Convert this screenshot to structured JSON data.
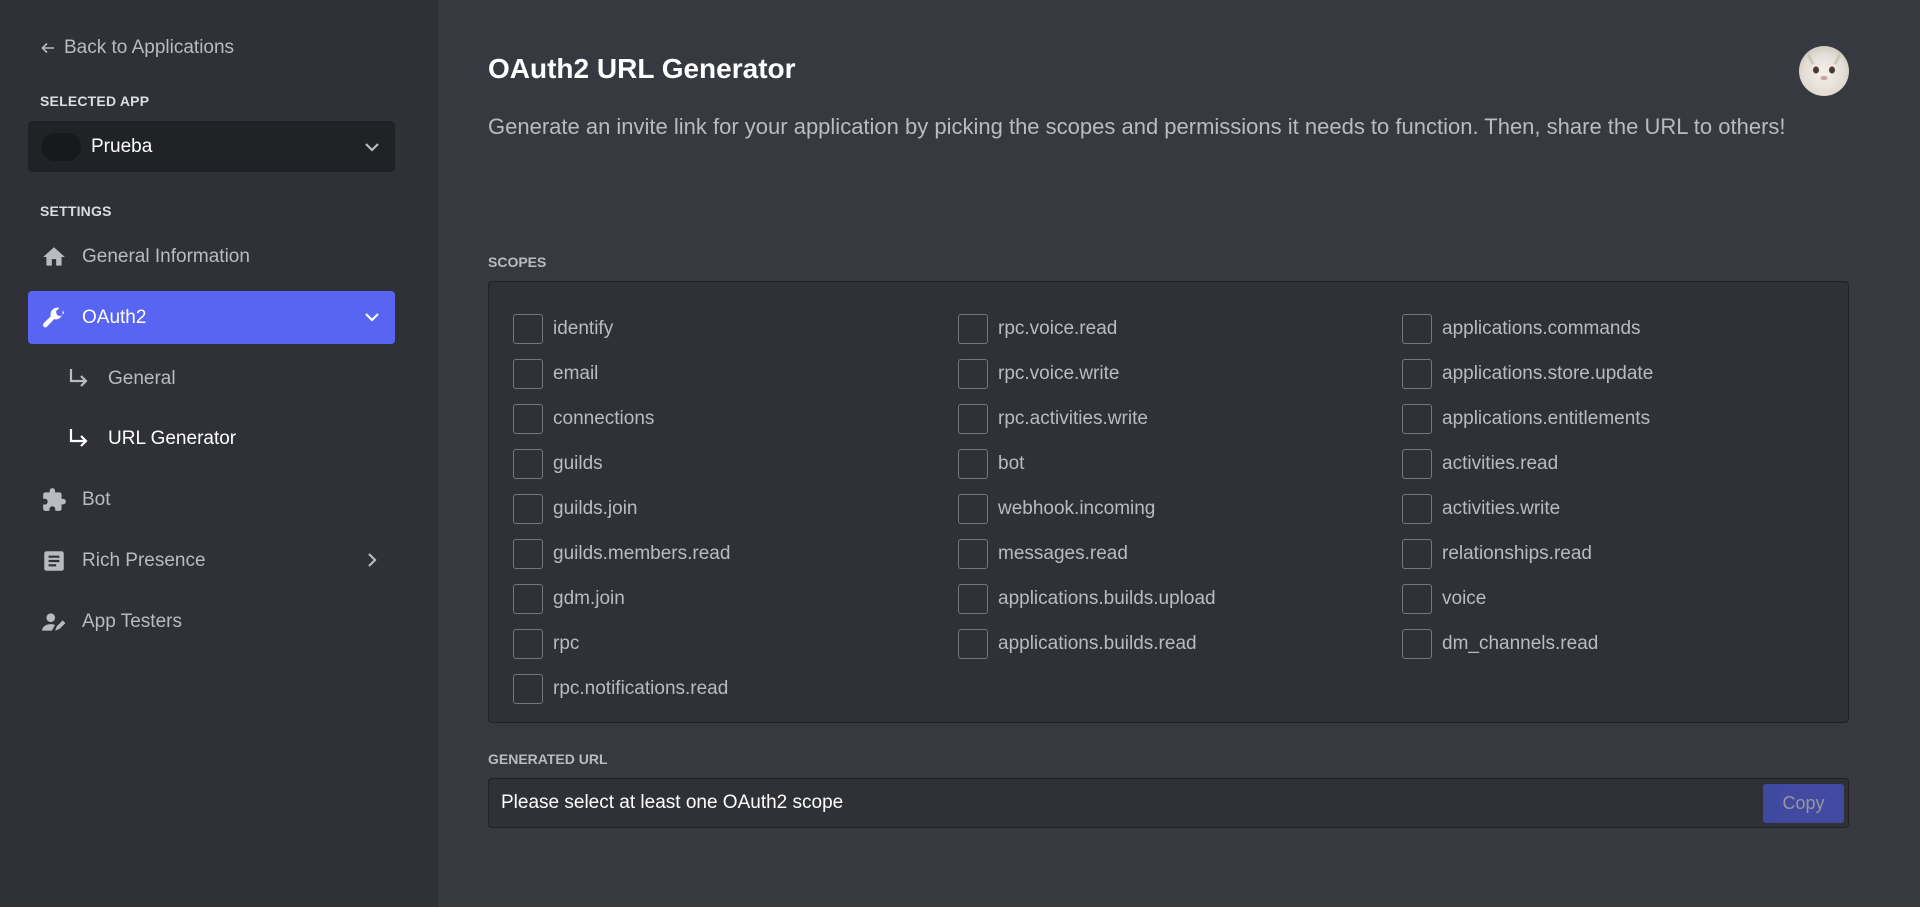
{
  "sidebar": {
    "back_label": "Back to Applications",
    "selected_app_heading": "SELECTED APP",
    "app_name": "Prueba",
    "settings_heading": "SETTINGS",
    "nav": {
      "general_information": "General Information",
      "oauth2": "OAuth2",
      "oauth2_general": "General",
      "oauth2_url_generator": "URL Generator",
      "bot": "Bot",
      "rich_presence": "Rich Presence",
      "app_testers": "App Testers"
    },
    "accent_color": "#5865f2"
  },
  "main": {
    "title": "OAuth2 URL Generator",
    "description": "Generate an invite link for your application by picking the scopes and permissions it needs to function. Then, share the URL to others!",
    "scopes_heading": "SCOPES",
    "scopes": {
      "col1": [
        "identify",
        "email",
        "connections",
        "guilds",
        "guilds.join",
        "guilds.members.read",
        "gdm.join",
        "rpc",
        "rpc.notifications.read"
      ],
      "col2": [
        "rpc.voice.read",
        "rpc.voice.write",
        "rpc.activities.write",
        "bot",
        "webhook.incoming",
        "messages.read",
        "applications.builds.upload",
        "applications.builds.read"
      ],
      "col3": [
        "applications.commands",
        "applications.store.update",
        "applications.entitlements",
        "activities.read",
        "activities.write",
        "relationships.read",
        "voice",
        "dm_channels.read"
      ]
    },
    "generated_url_heading": "GENERATED URL",
    "generated_url_value": "Please select at least one OAuth2 scope",
    "copy_label": "Copy"
  }
}
